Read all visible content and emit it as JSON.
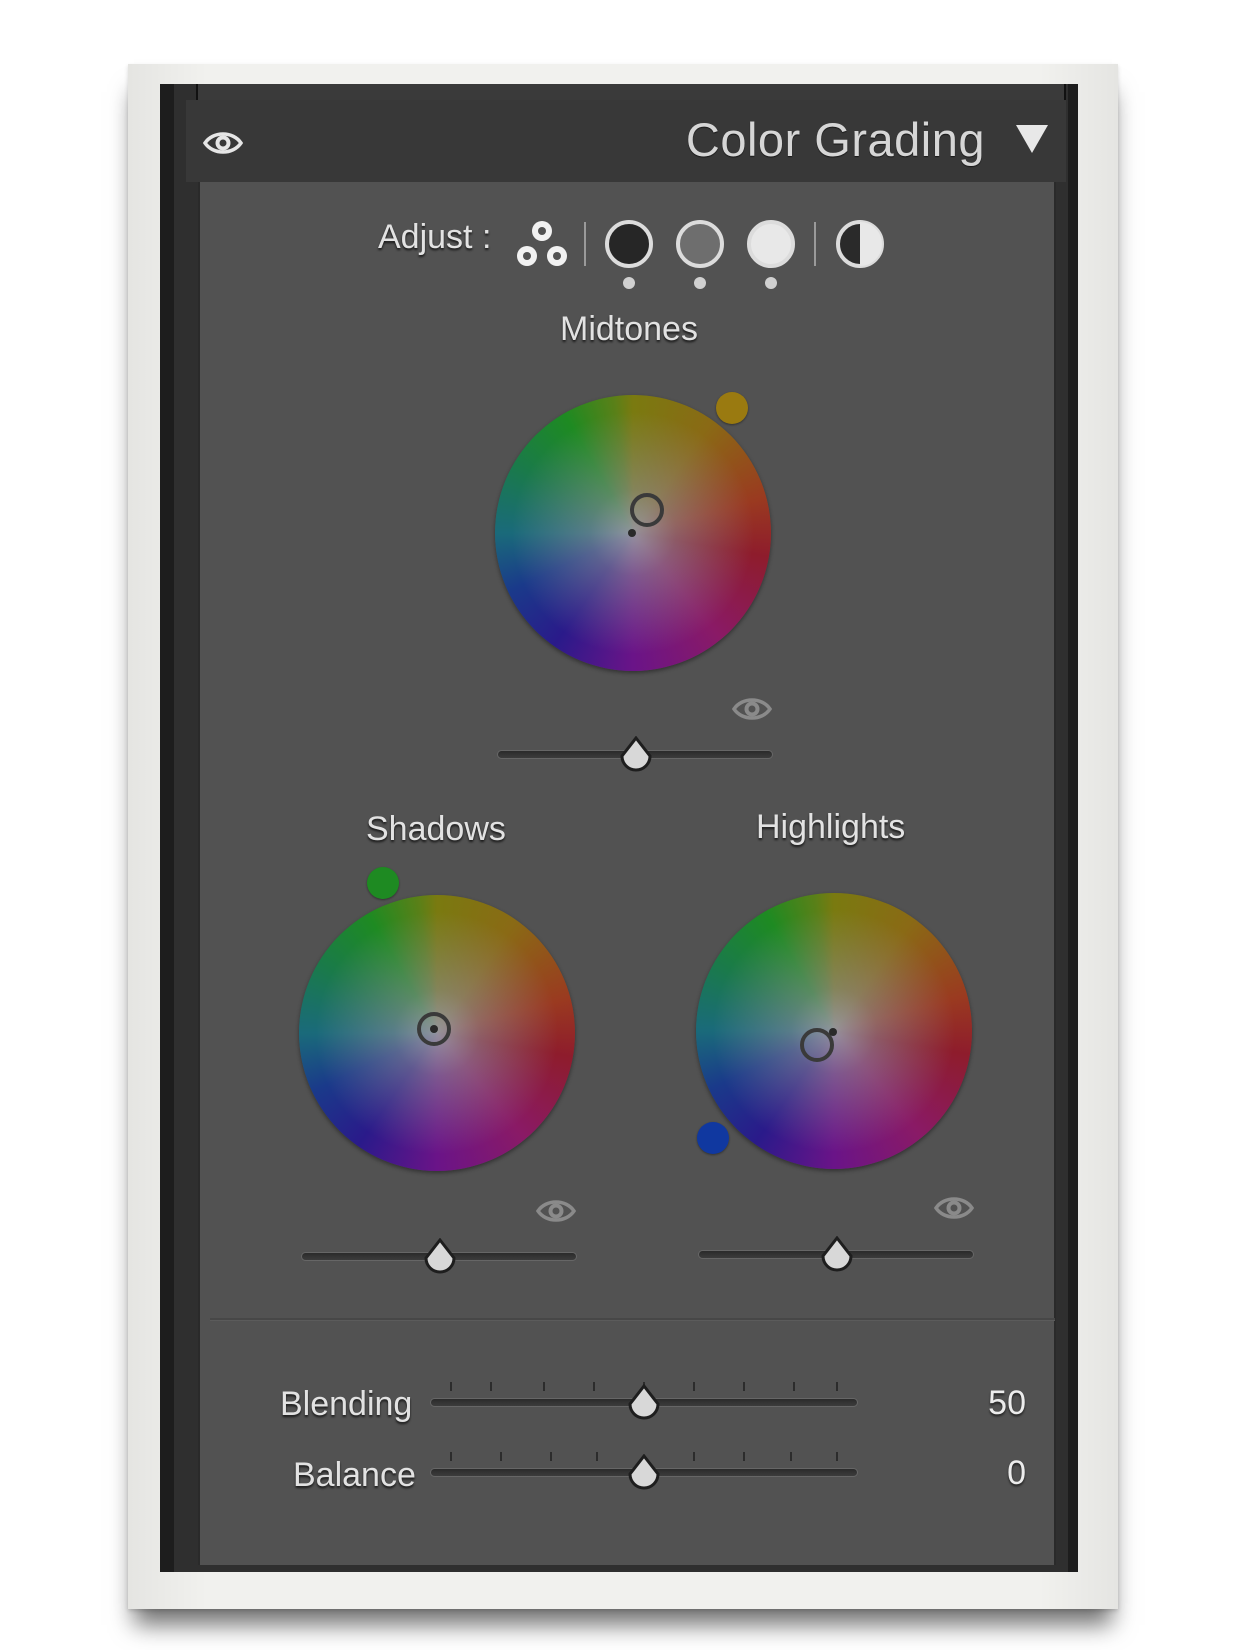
{
  "panel": {
    "title": "Color Grading",
    "adjust_label": "Adjust :",
    "adjust_modes": [
      "three-way",
      "shadows",
      "midtones",
      "highlights",
      "global"
    ]
  },
  "wheels": {
    "midtones": {
      "label": "Midtones",
      "luminance": 0.5
    },
    "shadows": {
      "label": "Shadows",
      "luminance": 0.5
    },
    "highlights": {
      "label": "Highlights",
      "luminance": 0.5
    }
  },
  "sliders": {
    "blending": {
      "label": "Blending",
      "value": "50"
    },
    "balance": {
      "label": "Balance",
      "value": "0"
    }
  },
  "colors": {
    "panel_bg": "#525252",
    "header_bg": "#383838",
    "midtones_hue": "#9a7a10",
    "shadows_hue": "#1e8a22",
    "highlights_hue": "#1038a0"
  },
  "icons": [
    "eye-icon",
    "chevron-down-icon",
    "three-circles-icon",
    "shadows-circle-icon",
    "midtones-circle-icon",
    "highlights-circle-icon",
    "global-half-circle-icon",
    "slider-thumb"
  ]
}
